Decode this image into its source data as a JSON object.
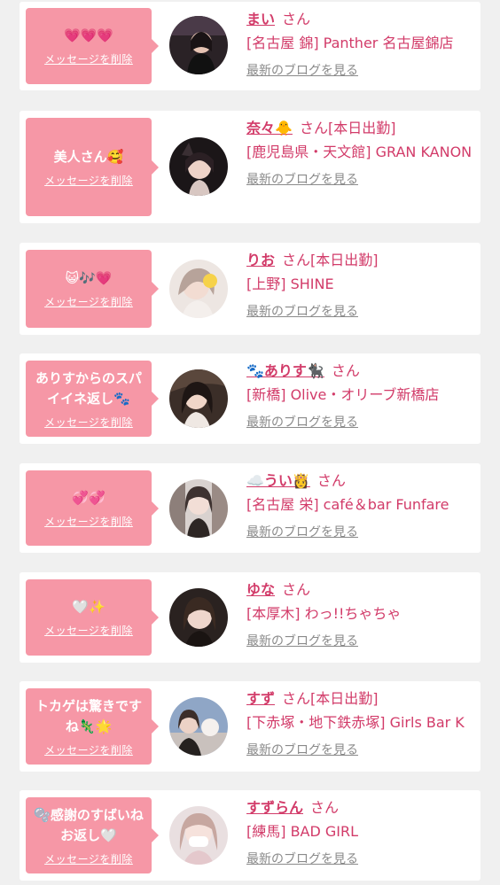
{
  "delete_label": "メッセージを削除",
  "honorific": "さん",
  "blog_label": "最新のブログを見る",
  "accent_color": "#d23b69",
  "bubble_color": "#f697a6",
  "entries": [
    {
      "message": "💗💗💗",
      "name": "まい",
      "status": "",
      "shop": "[名古屋 錦] Panther 名古屋錦店"
    },
    {
      "message": "美人さん🥰",
      "name": "奈々🐥",
      "status": "[本日出勤]",
      "shop": "[鹿児島県・天文館] GRAN KANON"
    },
    {
      "message": "😺🎶💗",
      "name": "りお",
      "status": "[本日出勤]",
      "shop": "[上野] SHINE"
    },
    {
      "message": "ありすからのスパイイネ返し🐾",
      "name": "🐾ありす🐈‍⬛",
      "status": "",
      "shop": "[新橋] Olive・オリーブ新橋店"
    },
    {
      "message": "💞💞",
      "name": "☁️うい👸",
      "status": "",
      "shop": "[名古屋 栄] café＆bar Funfare"
    },
    {
      "message": "🤍✨",
      "name": "ゆな",
      "status": "",
      "shop": "[本厚木] わっ!!ちゃちゃ"
    },
    {
      "message": "トカゲは驚きですね🦎🌟",
      "name": "すず",
      "status": "[本日出勤]",
      "shop": "[下赤塚・地下鉄赤塚] Girls Bar K"
    },
    {
      "message": "🫧感謝のすばいね お返し🤍",
      "name": "すずらん",
      "status": "",
      "shop": "[練馬] BAD GIRL"
    }
  ]
}
